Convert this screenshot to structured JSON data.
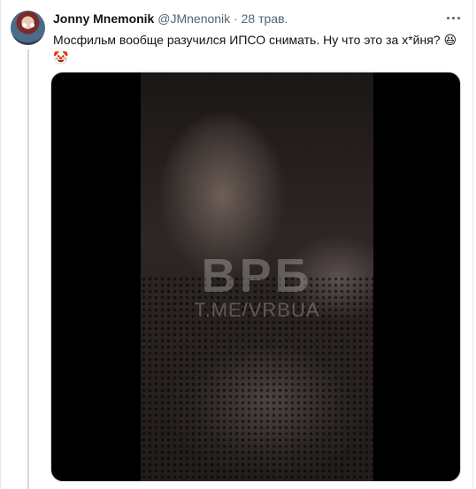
{
  "tweet": {
    "author": {
      "display_name": "Jonny Mnemonik",
      "handle": "@JMnenonik",
      "avatar": "avatar-icon"
    },
    "separator": "·",
    "date": "28 трав.",
    "text": "Мосфильм вообще разучился ИПСО снимать. Ну что это за х*йня?",
    "emoji_1": "😆",
    "emoji_2": "🤡",
    "menu_icon": "more-horizontal-icon"
  },
  "media": {
    "type": "video",
    "watermark_line1": "ВРБ",
    "watermark_line2": "T.ME/VRBUA"
  },
  "colors": {
    "text": "#0f1419",
    "secondary": "#536471",
    "border": "#cfd9de"
  }
}
